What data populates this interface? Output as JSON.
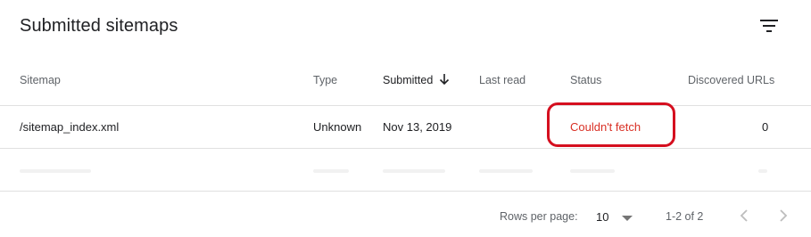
{
  "card": {
    "title": "Submitted sitemaps",
    "filter_icon": "filter-list-icon"
  },
  "table": {
    "columns": [
      "Sitemap",
      "Type",
      "Submitted",
      "Last read",
      "Status",
      "Discovered URLs"
    ],
    "sorted_column": "Submitted",
    "sort_direction": "descending",
    "rows": [
      {
        "sitemap": "/sitemap_index.xml",
        "type": "Unknown",
        "submitted": "Nov 13, 2019",
        "last_read": "",
        "status": "Couldn't fetch",
        "discovered_urls": "0"
      }
    ]
  },
  "footer": {
    "rows_per_page_label": "Rows per page:",
    "rows_per_page_value": "10",
    "range": "1-2 of 2",
    "prev_icon": "chevron-left-icon",
    "next_icon": "chevron-right-icon"
  },
  "colors": {
    "status_error": "#d93025",
    "annotation_ring": "#d50f1f",
    "divider": "#e0e0e0"
  }
}
